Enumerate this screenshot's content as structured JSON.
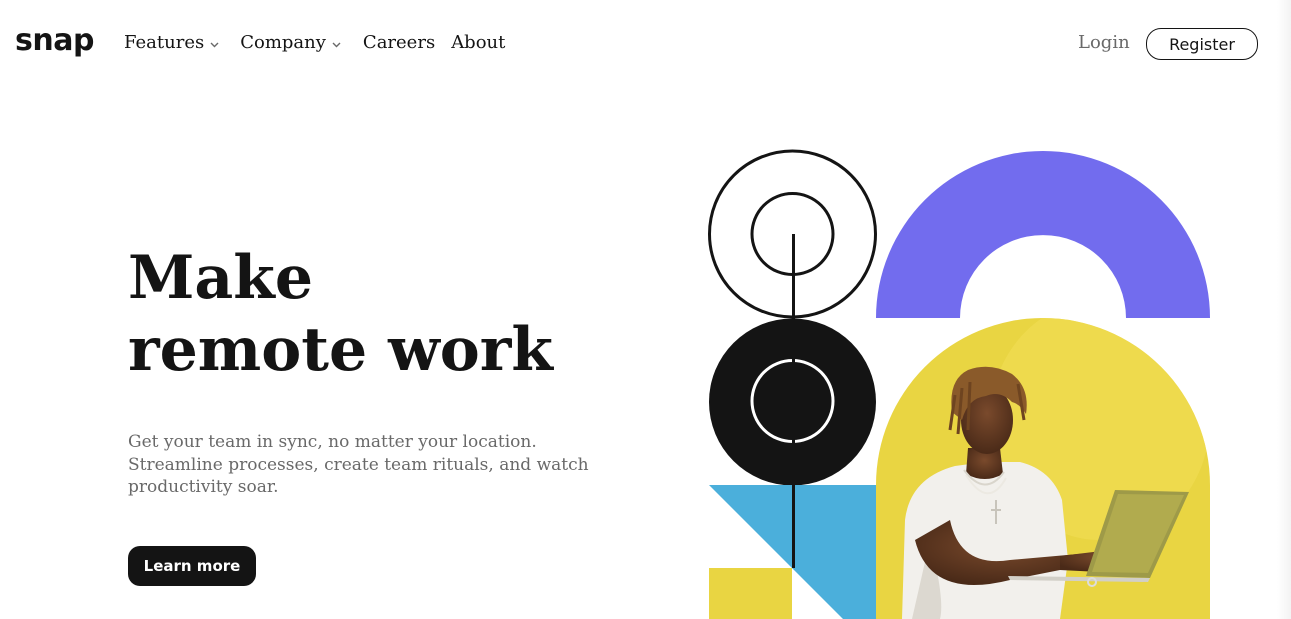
{
  "brand": {
    "logo_text": "snap"
  },
  "nav": {
    "items": [
      {
        "label": "Features",
        "has_dropdown": true,
        "icon": "chevron-down-icon"
      },
      {
        "label": "Company",
        "has_dropdown": true,
        "icon": "chevron-down-icon"
      },
      {
        "label": "Careers",
        "has_dropdown": false
      },
      {
        "label": "About",
        "has_dropdown": false
      }
    ]
  },
  "auth": {
    "login_label": "Login",
    "register_label": "Register"
  },
  "hero": {
    "title_line_1": "Make",
    "title_line_2": "remote work",
    "description": "Get your team in sync, no matter your location. Streamline processes, create team rituals, and watch productivity soar.",
    "cta_label": "Learn more"
  },
  "colors": {
    "text_dark": "#141414",
    "text_muted": "#696969",
    "accent_purple": "#726CEE",
    "accent_yellow": "#E9D542",
    "accent_blue": "#4BAFDB"
  }
}
